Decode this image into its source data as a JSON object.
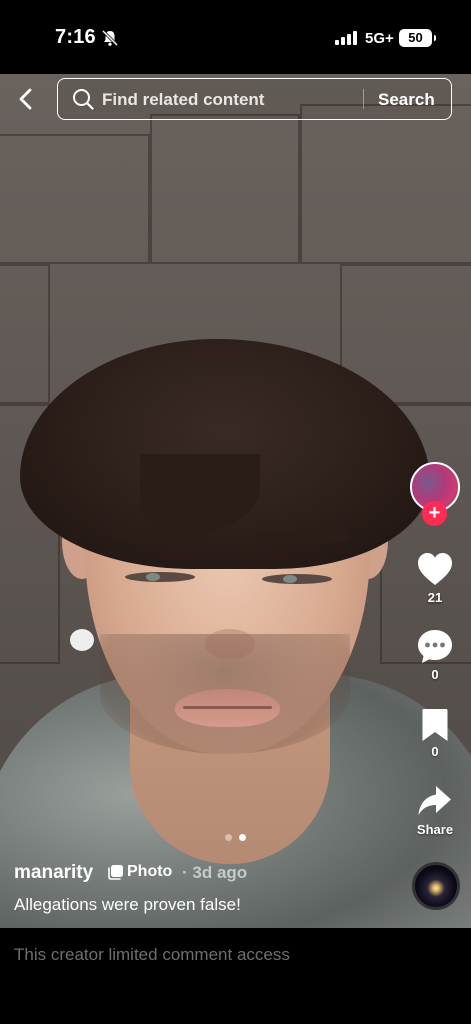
{
  "status_bar": {
    "time": "7:16",
    "network": "5G+",
    "battery": "50",
    "icons": [
      "bell-slash-icon",
      "signal-bars-icon"
    ]
  },
  "search": {
    "placeholder": "Find related content",
    "button_label": "Search"
  },
  "actions": {
    "likes": "21",
    "comments": "0",
    "saves": "0",
    "share_label": "Share",
    "icons": [
      "heart-icon",
      "comment-icon",
      "bookmark-icon",
      "share-icon",
      "plus-icon"
    ]
  },
  "post": {
    "username": "manarity",
    "media_type": "Photo",
    "age": "· 3d ago",
    "caption": "Allegations were proven false!",
    "current_page": 2,
    "total_pages": 2
  },
  "footer": {
    "comment_notice": "This creator limited comment access"
  },
  "colors": {
    "follow_accent": "#fe2c55",
    "background": "#000000",
    "muted_text": "#6e6e6e"
  }
}
